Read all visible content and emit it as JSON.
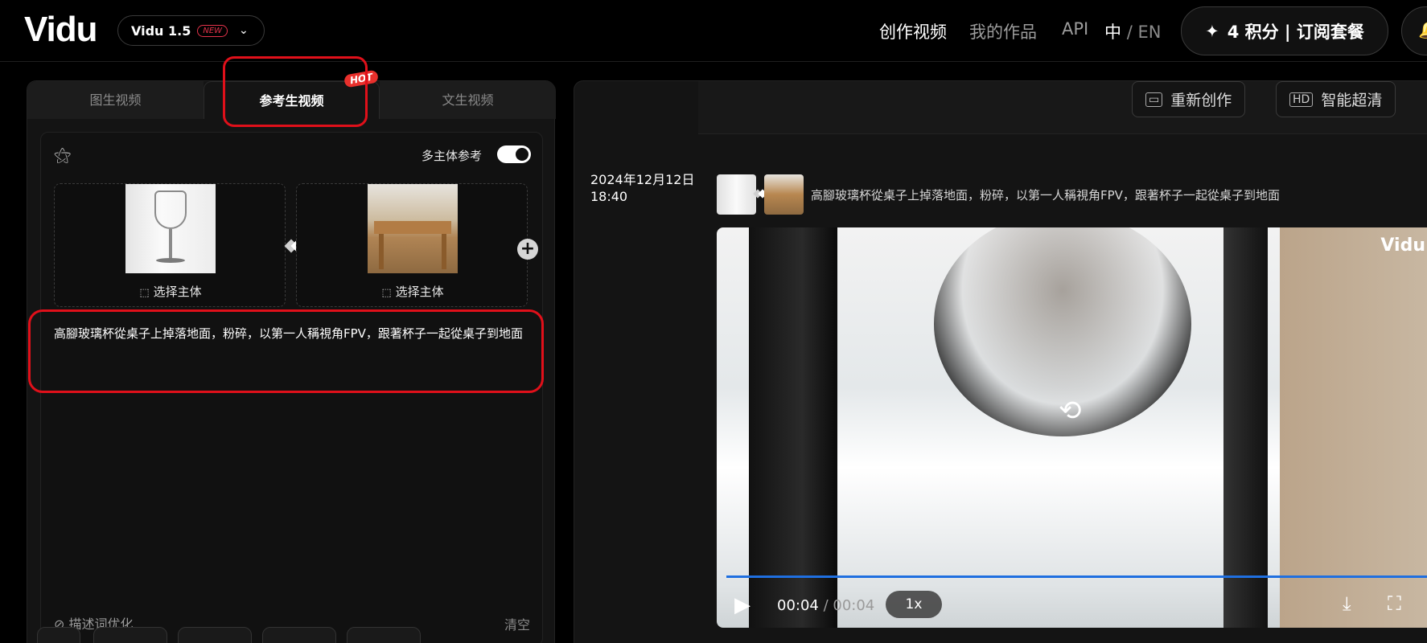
{
  "header": {
    "logo": "Vidu",
    "version_label": "Vidu 1.5",
    "version_badge": "NEW",
    "nav": [
      "创作视频",
      "我的作品",
      "API"
    ],
    "lang_zh": "中",
    "lang_sep": "/",
    "lang_en": "EN",
    "credits_label": "4 积分 | 订阅套餐"
  },
  "left_panel": {
    "tabs": [
      "图生视频",
      "参考生视频",
      "文生视频"
    ],
    "hot_badge": "HOT",
    "multi_subject_label": "多主体参考",
    "multi_subject_enabled": true,
    "cards": [
      {
        "label": "选择主体"
      },
      {
        "label": "选择主体"
      }
    ],
    "prompt_text": "高腳玻璃杯從桌子上掉落地面，粉碎，以第一人稱視角FPV，跟著杯子一起從桌子到地面",
    "optimize_label": "描述词优化",
    "clear_label": "清空"
  },
  "right_panel": {
    "buttons": [
      "重新创作",
      "智能超清"
    ],
    "date": "2024年12月12日",
    "time": "18:40",
    "prompt_text": "高腳玻璃杯從桌子上掉落地面，粉碎，以第一人稱視角FPV，跟著杯子一起從桌子到地面",
    "video": {
      "watermark": "Vidu",
      "current_time": "00:04",
      "time_sep": " / ",
      "total_time": "00:04",
      "speed": "1x",
      "progress": 1.0
    }
  },
  "colors": {
    "accent_red": "#e0101a",
    "progress_blue": "#1f6fe0",
    "badge_red": "#e3324a"
  }
}
